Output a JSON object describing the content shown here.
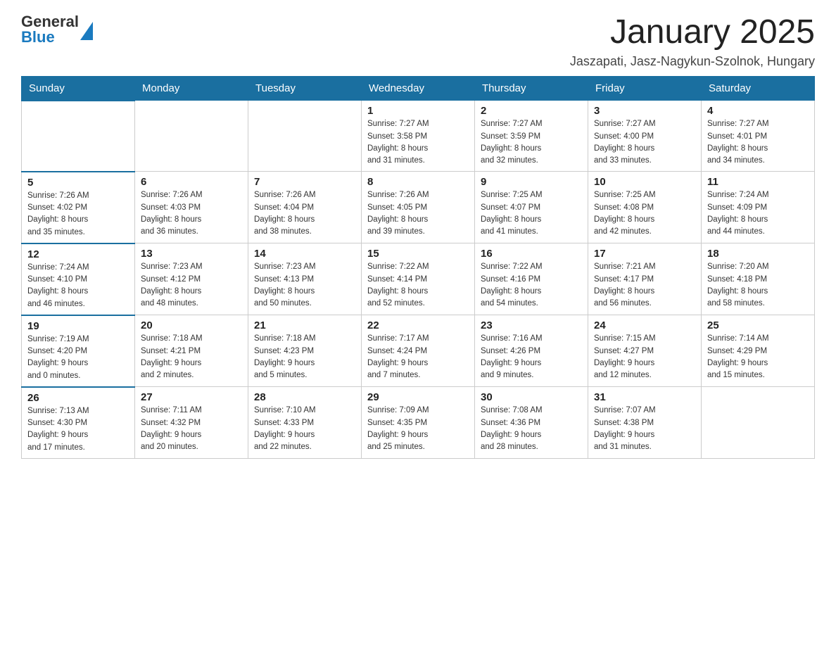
{
  "logo": {
    "text_general": "General",
    "text_blue": "Blue"
  },
  "header": {
    "month_year": "January 2025",
    "location": "Jaszapati, Jasz-Nagykun-Szolnok, Hungary"
  },
  "days_of_week": [
    "Sunday",
    "Monday",
    "Tuesday",
    "Wednesday",
    "Thursday",
    "Friday",
    "Saturday"
  ],
  "weeks": [
    {
      "days": [
        {
          "num": "",
          "info": ""
        },
        {
          "num": "",
          "info": ""
        },
        {
          "num": "",
          "info": ""
        },
        {
          "num": "1",
          "info": "Sunrise: 7:27 AM\nSunset: 3:58 PM\nDaylight: 8 hours\nand 31 minutes."
        },
        {
          "num": "2",
          "info": "Sunrise: 7:27 AM\nSunset: 3:59 PM\nDaylight: 8 hours\nand 32 minutes."
        },
        {
          "num": "3",
          "info": "Sunrise: 7:27 AM\nSunset: 4:00 PM\nDaylight: 8 hours\nand 33 minutes."
        },
        {
          "num": "4",
          "info": "Sunrise: 7:27 AM\nSunset: 4:01 PM\nDaylight: 8 hours\nand 34 minutes."
        }
      ]
    },
    {
      "days": [
        {
          "num": "5",
          "info": "Sunrise: 7:26 AM\nSunset: 4:02 PM\nDaylight: 8 hours\nand 35 minutes."
        },
        {
          "num": "6",
          "info": "Sunrise: 7:26 AM\nSunset: 4:03 PM\nDaylight: 8 hours\nand 36 minutes."
        },
        {
          "num": "7",
          "info": "Sunrise: 7:26 AM\nSunset: 4:04 PM\nDaylight: 8 hours\nand 38 minutes."
        },
        {
          "num": "8",
          "info": "Sunrise: 7:26 AM\nSunset: 4:05 PM\nDaylight: 8 hours\nand 39 minutes."
        },
        {
          "num": "9",
          "info": "Sunrise: 7:25 AM\nSunset: 4:07 PM\nDaylight: 8 hours\nand 41 minutes."
        },
        {
          "num": "10",
          "info": "Sunrise: 7:25 AM\nSunset: 4:08 PM\nDaylight: 8 hours\nand 42 minutes."
        },
        {
          "num": "11",
          "info": "Sunrise: 7:24 AM\nSunset: 4:09 PM\nDaylight: 8 hours\nand 44 minutes."
        }
      ]
    },
    {
      "days": [
        {
          "num": "12",
          "info": "Sunrise: 7:24 AM\nSunset: 4:10 PM\nDaylight: 8 hours\nand 46 minutes."
        },
        {
          "num": "13",
          "info": "Sunrise: 7:23 AM\nSunset: 4:12 PM\nDaylight: 8 hours\nand 48 minutes."
        },
        {
          "num": "14",
          "info": "Sunrise: 7:23 AM\nSunset: 4:13 PM\nDaylight: 8 hours\nand 50 minutes."
        },
        {
          "num": "15",
          "info": "Sunrise: 7:22 AM\nSunset: 4:14 PM\nDaylight: 8 hours\nand 52 minutes."
        },
        {
          "num": "16",
          "info": "Sunrise: 7:22 AM\nSunset: 4:16 PM\nDaylight: 8 hours\nand 54 minutes."
        },
        {
          "num": "17",
          "info": "Sunrise: 7:21 AM\nSunset: 4:17 PM\nDaylight: 8 hours\nand 56 minutes."
        },
        {
          "num": "18",
          "info": "Sunrise: 7:20 AM\nSunset: 4:18 PM\nDaylight: 8 hours\nand 58 minutes."
        }
      ]
    },
    {
      "days": [
        {
          "num": "19",
          "info": "Sunrise: 7:19 AM\nSunset: 4:20 PM\nDaylight: 9 hours\nand 0 minutes."
        },
        {
          "num": "20",
          "info": "Sunrise: 7:18 AM\nSunset: 4:21 PM\nDaylight: 9 hours\nand 2 minutes."
        },
        {
          "num": "21",
          "info": "Sunrise: 7:18 AM\nSunset: 4:23 PM\nDaylight: 9 hours\nand 5 minutes."
        },
        {
          "num": "22",
          "info": "Sunrise: 7:17 AM\nSunset: 4:24 PM\nDaylight: 9 hours\nand 7 minutes."
        },
        {
          "num": "23",
          "info": "Sunrise: 7:16 AM\nSunset: 4:26 PM\nDaylight: 9 hours\nand 9 minutes."
        },
        {
          "num": "24",
          "info": "Sunrise: 7:15 AM\nSunset: 4:27 PM\nDaylight: 9 hours\nand 12 minutes."
        },
        {
          "num": "25",
          "info": "Sunrise: 7:14 AM\nSunset: 4:29 PM\nDaylight: 9 hours\nand 15 minutes."
        }
      ]
    },
    {
      "days": [
        {
          "num": "26",
          "info": "Sunrise: 7:13 AM\nSunset: 4:30 PM\nDaylight: 9 hours\nand 17 minutes."
        },
        {
          "num": "27",
          "info": "Sunrise: 7:11 AM\nSunset: 4:32 PM\nDaylight: 9 hours\nand 20 minutes."
        },
        {
          "num": "28",
          "info": "Sunrise: 7:10 AM\nSunset: 4:33 PM\nDaylight: 9 hours\nand 22 minutes."
        },
        {
          "num": "29",
          "info": "Sunrise: 7:09 AM\nSunset: 4:35 PM\nDaylight: 9 hours\nand 25 minutes."
        },
        {
          "num": "30",
          "info": "Sunrise: 7:08 AM\nSunset: 4:36 PM\nDaylight: 9 hours\nand 28 minutes."
        },
        {
          "num": "31",
          "info": "Sunrise: 7:07 AM\nSunset: 4:38 PM\nDaylight: 9 hours\nand 31 minutes."
        },
        {
          "num": "",
          "info": ""
        }
      ]
    }
  ]
}
